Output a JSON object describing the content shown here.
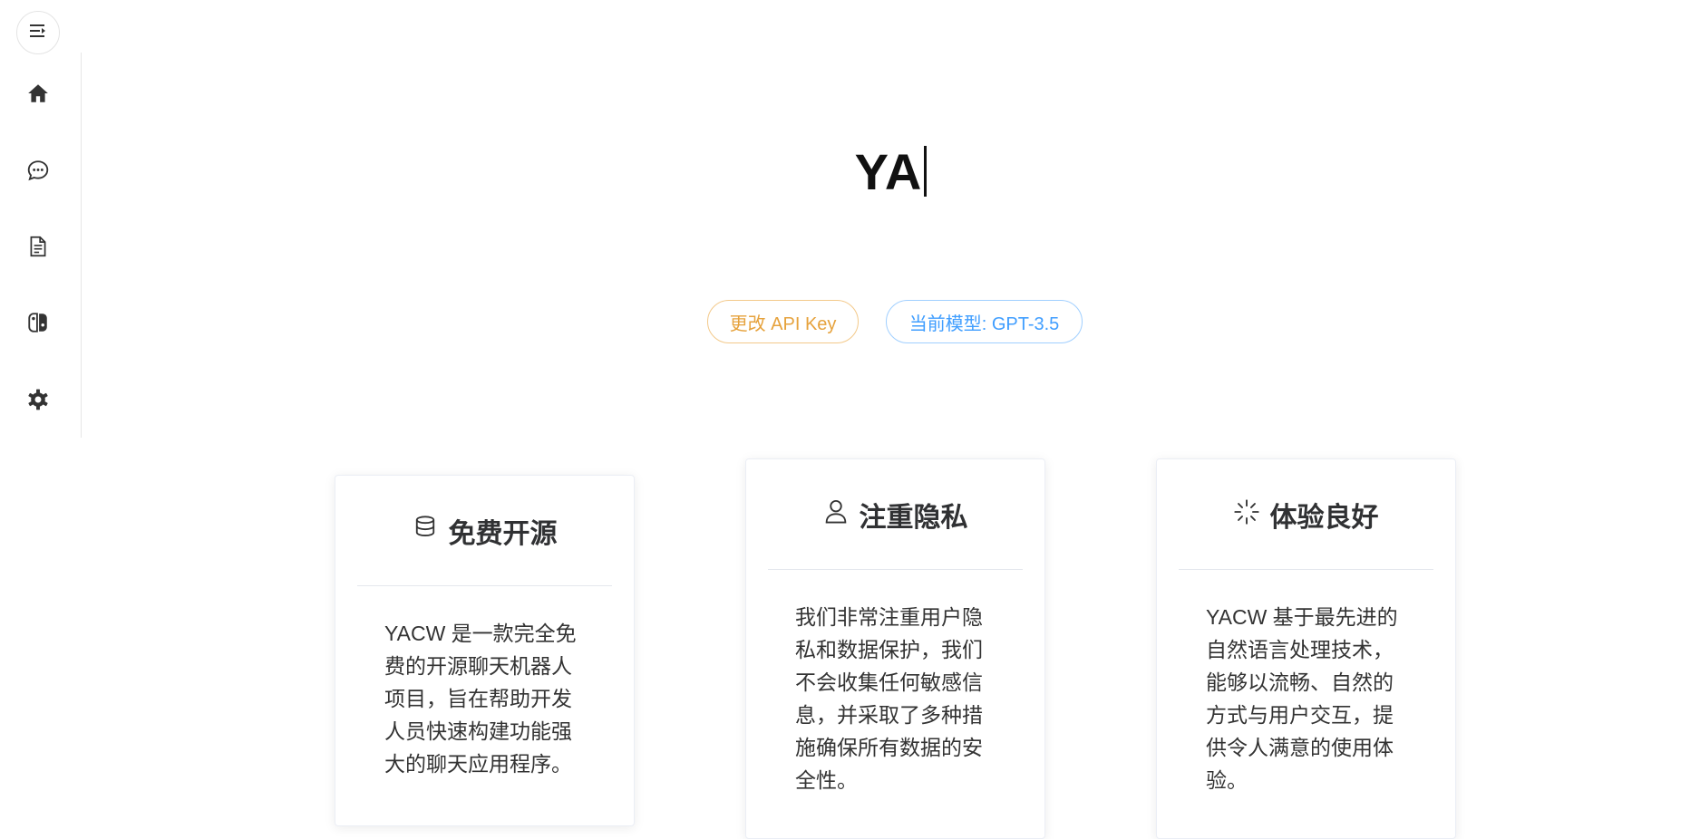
{
  "sidebar": {
    "toggle_icon": "menu-collapse-icon",
    "items": [
      {
        "icon": "home-icon",
        "name": "home"
      },
      {
        "icon": "chat-bubble-icon",
        "name": "chat"
      },
      {
        "icon": "document-icon",
        "name": "docs"
      },
      {
        "icon": "game-controller-icon",
        "name": "game"
      },
      {
        "icon": "gear-icon",
        "name": "settings"
      }
    ]
  },
  "hero": {
    "title": "YA"
  },
  "actions": {
    "api_key_label": "更改 API Key",
    "model_label": "当前模型: GPT-3.5"
  },
  "cards": [
    {
      "icon": "database-icon",
      "title": "免费开源",
      "text": "YACW 是一款完全免费的开源聊天机器人项目，旨在帮助开发人员快速构建功能强大的聊天应用程序。"
    },
    {
      "icon": "user-icon",
      "title": "注重隐私",
      "text": "我们非常注重用户隐私和数据保护，我们不会收集任何敏感信息，并采取了多种措施确保所有数据的安全性。"
    },
    {
      "icon": "loading-spinner-icon",
      "title": "体验良好",
      "text": "YACW 基于最先进的自然语言处理技术，能够以流畅、自然的方式与用户交互，提供令人满意的使用体验。"
    }
  ],
  "colors": {
    "warning": "#e6a23c",
    "primary": "#409eff",
    "text": "#303133"
  }
}
